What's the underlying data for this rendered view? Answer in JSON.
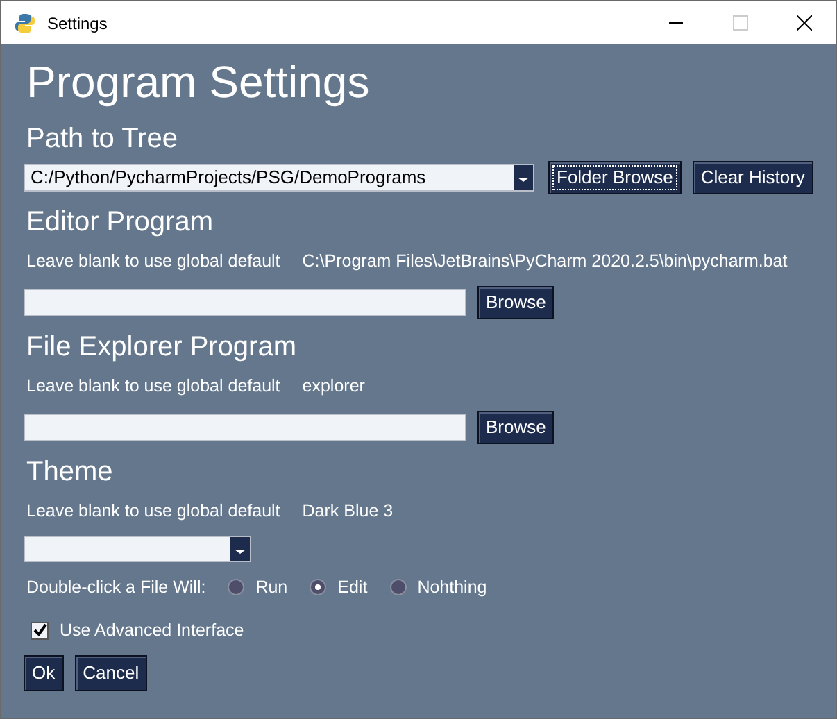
{
  "window": {
    "title": "Settings"
  },
  "heading": "Program Settings",
  "path_section": {
    "title": "Path to Tree",
    "value": "C:/Python/PycharmProjects/PSG/DemoPrograms",
    "buttons": [
      {
        "label": "Folder Browse",
        "focused": true
      },
      {
        "label": "Clear History",
        "focused": false
      }
    ]
  },
  "program_sections": [
    {
      "title": "Editor Program",
      "hint": "Leave blank to use global default",
      "default": "C:\\Program Files\\JetBrains\\PyCharm 2020.2.5\\bin\\pycharm.bat",
      "button": "Browse"
    },
    {
      "title": "File Explorer Program",
      "hint": "Leave blank to use global default",
      "default": "explorer",
      "button": "Browse"
    }
  ],
  "theme_section": {
    "title": "Theme",
    "hint": "Leave blank to use global default",
    "default": "Dark Blue 3"
  },
  "double_click": {
    "label": "Double-click a File Will:",
    "options": [
      {
        "label": "Run",
        "selected": false
      },
      {
        "label": "Edit",
        "selected": true
      },
      {
        "label": "Nohthing",
        "selected": false
      }
    ]
  },
  "advanced": {
    "label": "Use Advanced Interface",
    "checked": true
  },
  "buttons": [
    "Ok",
    "Cancel"
  ]
}
